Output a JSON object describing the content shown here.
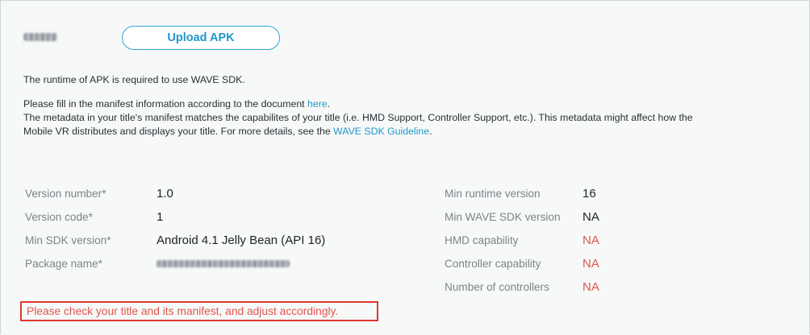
{
  "upload": {
    "button_label": "Upload APK"
  },
  "notes": {
    "line1": "The runtime of APK is required to use WAVE SDK.",
    "line2_pre": "Please fill in the manifest information according to the document ",
    "line2_link": "here",
    "line2_post": ".",
    "line3": "The metadata in your title's manifest matches the capabilites of your title (i.e. HMD Support, Controller Support, etc.). This metadata might affect how the",
    "line4_pre": "Mobile VR distributes and displays your title. For more details, see the ",
    "line4_link": "WAVE SDK Guideline",
    "line4_post": "."
  },
  "left_fields": [
    {
      "label": "Version number*",
      "value": "1.0"
    },
    {
      "label": "Version code*",
      "value": "1"
    },
    {
      "label": "Min SDK version*",
      "value": "Android 4.1 Jelly Bean (API 16)"
    },
    {
      "label": "Package name*",
      "value": ""
    }
  ],
  "right_fields": [
    {
      "label": "Min runtime version",
      "value": "16"
    },
    {
      "label": "Min WAVE SDK version",
      "value": "NA"
    },
    {
      "label": "HMD capability",
      "value": "NA"
    },
    {
      "label": "Controller capability",
      "value": "NA"
    },
    {
      "label": "Number of controllers",
      "value": "NA"
    }
  ],
  "warning": "Please check your title and its manifest, and adjust accordingly.",
  "colors": {
    "accent": "#1f98cc",
    "error": "#e0362c",
    "na": "#e05454"
  }
}
